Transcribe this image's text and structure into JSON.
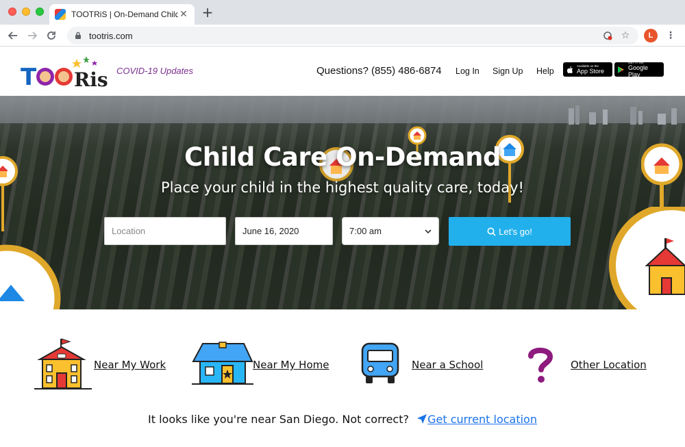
{
  "browser": {
    "tab_title": "TOOTRiS | On-Demand Child C",
    "tab_close": "✕",
    "new_tab": "+",
    "url": "tootris.com",
    "profile_initial": "L"
  },
  "header": {
    "logo_text": "TOOTRiS",
    "covid_link": "COVID-19 Updates",
    "phone": "Questions? (855) 486-6874",
    "nav": {
      "login": "Log In",
      "signup": "Sign Up",
      "help": "Help"
    },
    "app_store": {
      "small": "Available on the",
      "big": "App Store"
    },
    "google_play": {
      "small": "GET IT ON",
      "big": "Google Play"
    }
  },
  "hero": {
    "title": "Child Care On-Demand",
    "subtitle": "Place your child in the highest quality care, today!",
    "location_placeholder": "Location",
    "date_value": "June 16, 2020",
    "time_value": "7:00 am",
    "button_label": "Let's go!"
  },
  "options": {
    "work": "Near My Work",
    "home": "Near My Home",
    "school": "Near a School",
    "other": "Other Location"
  },
  "location_notice": {
    "text": "It looks like you're near San Diego. Not correct?",
    "link": "Get current location"
  },
  "colors": {
    "accent_blue": "#22b0ec",
    "covid_purple": "#7b2d8e",
    "link_blue": "#1a73e8",
    "pin_gold": "#e0a82a"
  }
}
